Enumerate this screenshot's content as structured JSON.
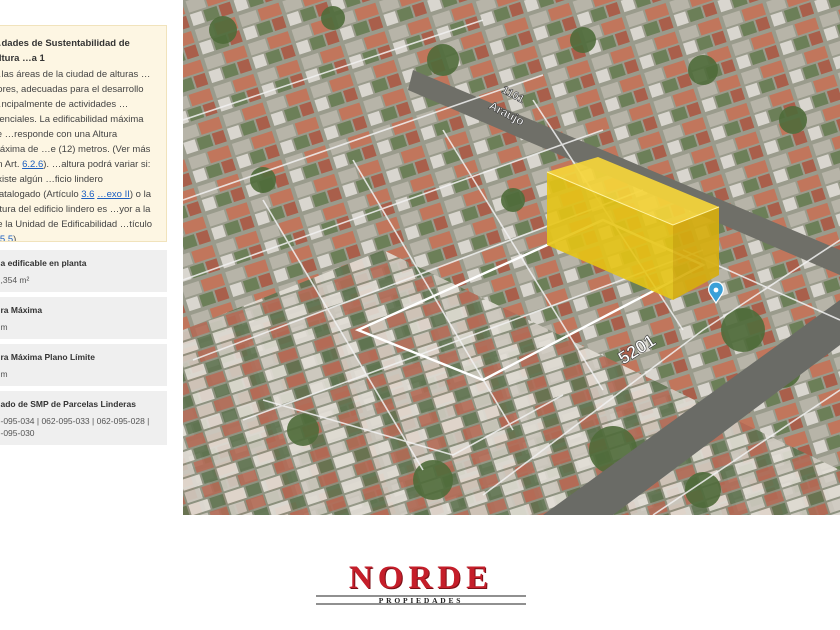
{
  "info": {
    "title": "…dades de Sustentabilidad de Altura …a 1",
    "body_1": "…las áreas de la ciudad de alturas …nores, adecuadas para el desarrollo …ncipalmente de actividades …idenciales. La edificabilidad máxima se …responde con una Altura Máxima de …e (12) metros. (Ver más en Art. ",
    "link_1": "6.2.6",
    "body_2": "). …altura podrá variar si: existe algún …ficio lindero Catalogado (Artículo ",
    "link_2": "3.6",
    "body_3": " ",
    "link_3": "…exo II",
    "body_4": ") o la altura del edificio lindero es …yor a la de la Unidad de Edificabilidad …tículo ",
    "link_4": "6.5.5",
    "body_5": ")."
  },
  "stats": [
    {
      "label": "…a edificable en planta",
      "value": "…,354 m²"
    },
    {
      "label": "…ra Máxima",
      "value": "…m"
    },
    {
      "label": "…ra Máxima Plano Límite",
      "value": "…m"
    },
    {
      "label": "…ado de SMP de Parcelas Linderas",
      "value": "…-095-034 | 062-095-033 | 062-095-028 | …-095-030"
    }
  ],
  "map": {
    "street_1": "Araujo",
    "street_1_number": "1101",
    "street_2_number": "5201",
    "building_color": "#f2cc16",
    "marker_color": "#3aa0d8"
  },
  "logo": {
    "brand": "NORDE",
    "tagline": "PROPIEDADES",
    "brand_color": "#c51e2a"
  }
}
